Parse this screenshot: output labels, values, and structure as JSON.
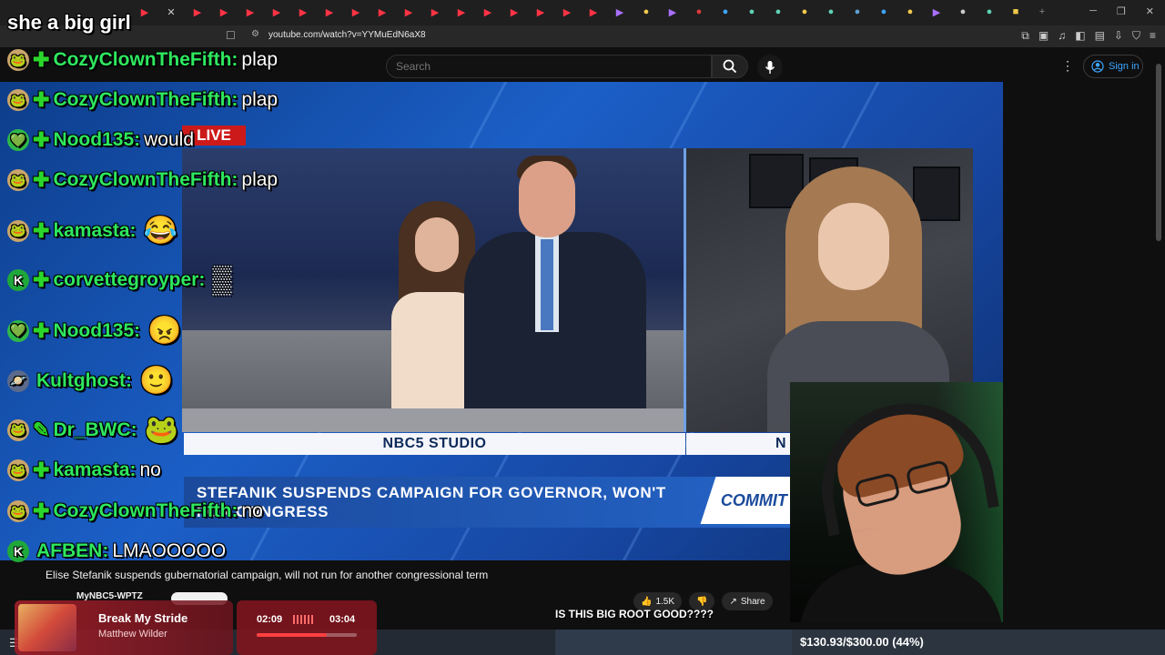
{
  "browser": {
    "url": "youtube.com/watch?v=YYMuEdN6aX8"
  },
  "youtube": {
    "search_placeholder": "Search",
    "signin_label": "Sign in",
    "live_badge": "LIVE",
    "video_title": "Elise Stefanik suspends gubernatorial campaign, will not run for another congressional term",
    "channel_name": "MyNBC5-WPTZ",
    "like_count": "1.5K",
    "share_label": "Share"
  },
  "broadcast": {
    "studio_label": "NBC5 STUDIO",
    "studio_label_right": "N",
    "headline_line1": "STEFANIK SUSPENDS CAMPAIGN FOR GOVERNOR, WON'T",
    "headline_line2": "FOR CONGRESS",
    "commit_text": "COMMIT"
  },
  "stream_overlay": {
    "top_message": "she a big girl",
    "chat": [
      {
        "user": "CozyClownTheFifth:",
        "message": "plap",
        "avatar": "🐸",
        "badge": "✚",
        "emote": ""
      },
      {
        "user": "CozyClownTheFifth:",
        "message": "plap",
        "avatar": "🐸",
        "badge": "✚",
        "emote": ""
      },
      {
        "user": "Nood135:",
        "message": "would",
        "avatar": "💚",
        "badge": "✚",
        "emote": ""
      },
      {
        "user": "CozyClownTheFifth:",
        "message": "plap",
        "avatar": "🐸",
        "badge": "✚",
        "emote": ""
      },
      {
        "user": "kamasta:",
        "message": "",
        "avatar": "🐸",
        "badge": "✚",
        "emote": "😂"
      },
      {
        "user": "corvettegroyper:",
        "message": "",
        "avatar": "K",
        "badge": "✚",
        "emote": "▒"
      },
      {
        "user": "Nood135:",
        "message": "",
        "avatar": "💚",
        "badge": "✚",
        "emote": "😠"
      },
      {
        "user": "Kultghost:",
        "message": "",
        "avatar": "🪐",
        "badge": "",
        "emote": "🙂"
      },
      {
        "user": "Dr_BWC:",
        "message": "",
        "avatar": "🐸",
        "badge": "✎",
        "emote": "🐸"
      },
      {
        "user": "kamasta:",
        "message": "no",
        "avatar": "🐸",
        "badge": "✚",
        "emote": ""
      },
      {
        "user": "CozyClownTheFifth:",
        "message": "no",
        "avatar": "🐸",
        "badge": "✚",
        "emote": ""
      },
      {
        "user": "AFBEN:",
        "message": "LMAOOOOO",
        "avatar": "K",
        "badge": "",
        "emote": ""
      }
    ],
    "caption": "IS THIS BIG ROOT GOOD????",
    "now_playing": {
      "title": "Break My Stride",
      "artist": "Matthew Wilder",
      "elapsed": "02:09",
      "total": "03:04",
      "progress": 0.701
    },
    "goal_text": "$130.93/$300.00 (44%)"
  }
}
